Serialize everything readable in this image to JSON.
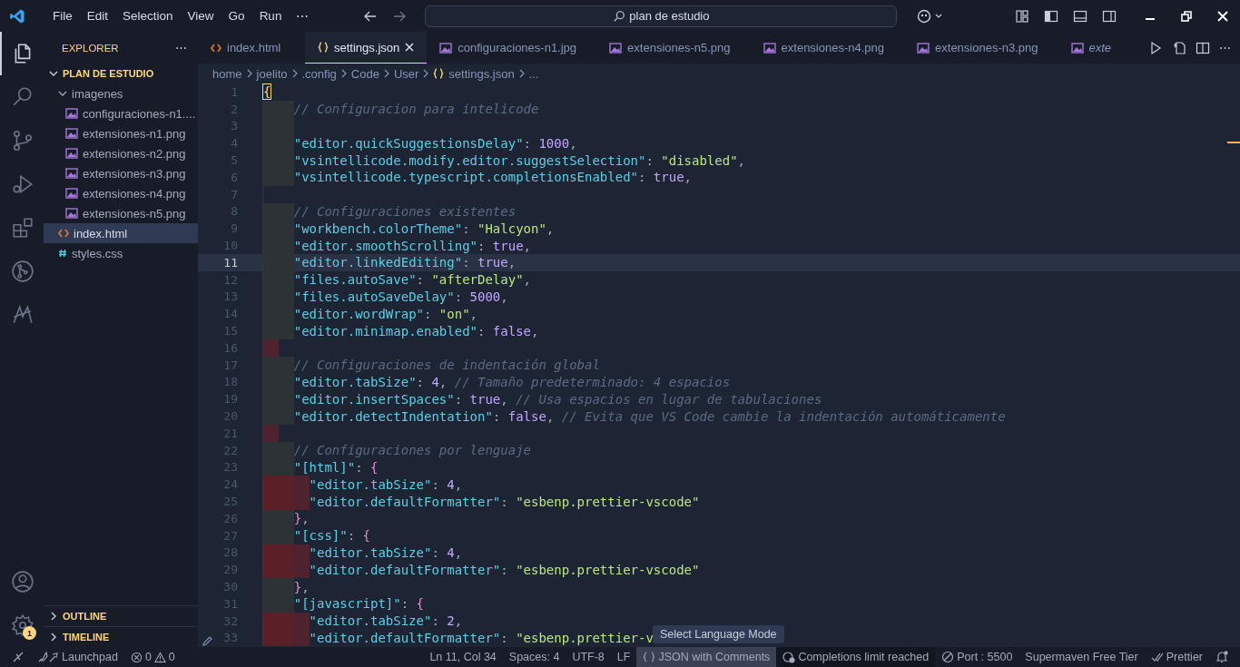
{
  "title_bar": {
    "menu": [
      "File",
      "Edit",
      "Selection",
      "View",
      "Go",
      "Run",
      "⋯"
    ],
    "search": {
      "value": "plan de estudio"
    }
  },
  "activity_bar": {
    "top": [
      {
        "kind": "explorer",
        "selected": true
      },
      {
        "kind": "search",
        "selected": false
      },
      {
        "kind": "source-control",
        "selected": false
      },
      {
        "kind": "run-debug",
        "selected": false
      },
      {
        "kind": "extensions",
        "selected": false
      },
      {
        "kind": "git-graph",
        "selected": false
      },
      {
        "kind": "custom",
        "selected": false
      }
    ],
    "bottom": [
      {
        "kind": "account"
      },
      {
        "kind": "settings",
        "badge": "1"
      }
    ]
  },
  "sidebar": {
    "title": "EXPLORER",
    "more": "⋯",
    "section": {
      "name": "PLAN DE ESTUDIO",
      "expanded": true,
      "children": [
        {
          "name": "imagenes",
          "kind": "folder",
          "expanded": true,
          "selected": false,
          "children": [
            {
              "name": "configuraciones-n1....",
              "kind": "image",
              "selected": false
            },
            {
              "name": "extensiones-n1.png",
              "kind": "image",
              "selected": false
            },
            {
              "name": "extensiones-n2.png",
              "kind": "image",
              "selected": false
            },
            {
              "name": "extensiones-n3.png",
              "kind": "image",
              "selected": false
            },
            {
              "name": "extensiones-n4.png",
              "kind": "image",
              "selected": false
            },
            {
              "name": "extensiones-n5.png",
              "kind": "image",
              "selected": false
            }
          ]
        },
        {
          "name": "index.html",
          "kind": "html",
          "selected": true
        },
        {
          "name": "styles.css",
          "kind": "css",
          "selected": false
        }
      ]
    },
    "panels": [
      {
        "name": "OUTLINE",
        "expanded": false
      },
      {
        "name": "TIMELINE",
        "expanded": false
      }
    ]
  },
  "tabs": [
    {
      "label": "index.html",
      "kind": "html",
      "selected": false,
      "preview": false
    },
    {
      "label": "settings.json",
      "kind": "json",
      "selected": true,
      "preview": false
    },
    {
      "label": "configuraciones-n1.jpg",
      "kind": "image",
      "selected": false,
      "preview": false
    },
    {
      "label": "extensiones-n5.png",
      "kind": "image",
      "selected": false,
      "preview": false
    },
    {
      "label": "extensiones-n4.png",
      "kind": "image",
      "selected": false,
      "preview": false
    },
    {
      "label": "extensiones-n3.png",
      "kind": "image",
      "selected": false,
      "preview": false
    },
    {
      "label": "exte",
      "kind": "image",
      "selected": false,
      "preview": true
    }
  ],
  "breadcrumbs": [
    {
      "text": "home",
      "kind": "folder"
    },
    {
      "text": "joelito",
      "kind": "folder"
    },
    {
      "text": ".config",
      "kind": "folder"
    },
    {
      "text": "Code",
      "kind": "folder"
    },
    {
      "text": "User",
      "kind": "folder"
    },
    {
      "text": "settings.json",
      "kind": "json"
    },
    {
      "text": "...",
      "kind": "folder"
    }
  ],
  "editor": {
    "lines": [
      {
        "number": "1",
        "current": false,
        "tokens": [
          {
            "kind": "brace-match",
            "text": "{"
          }
        ]
      },
      {
        "number": "2",
        "current": false,
        "indent": [
          {
            "kind": "ok"
          }
        ],
        "tokens": [
          {
            "kind": "comment",
            "text": "// Configuracion para intelicode"
          }
        ]
      },
      {
        "number": "3",
        "current": false,
        "indent": [
          {
            "kind": "ok"
          }
        ]
      },
      {
        "number": "4",
        "current": false,
        "indent": [
          {
            "kind": "ok"
          }
        ],
        "tokens": [
          {
            "kind": "key",
            "text": "\"editor.quickSuggestionsDelay\""
          },
          {
            "kind": "punct",
            "text": ": "
          },
          {
            "kind": "num",
            "text": "1000"
          },
          {
            "kind": "punct",
            "text": ","
          }
        ]
      },
      {
        "number": "5",
        "current": false,
        "indent": [
          {
            "kind": "ok"
          }
        ],
        "tokens": [
          {
            "kind": "key",
            "text": "\"vsintellicode.modify.editor.suggestSelection\""
          },
          {
            "kind": "punct",
            "text": ": "
          },
          {
            "kind": "str",
            "text": "\"disabled\""
          },
          {
            "kind": "punct",
            "text": ","
          }
        ]
      },
      {
        "number": "6",
        "current": false,
        "indent": [
          {
            "kind": "ok"
          }
        ],
        "tokens": [
          {
            "kind": "key",
            "text": "\"vsintellicode.typescript.completionsEnabled\""
          },
          {
            "kind": "punct",
            "text": ": "
          },
          {
            "kind": "bool",
            "text": "true"
          },
          {
            "kind": "punct",
            "text": ","
          }
        ]
      },
      {
        "number": "7",
        "current": false
      },
      {
        "number": "8",
        "current": false,
        "indent": [
          {
            "kind": "ok"
          }
        ],
        "tokens": [
          {
            "kind": "comment",
            "text": "// Configuraciones existentes"
          }
        ]
      },
      {
        "number": "9",
        "current": false,
        "indent": [
          {
            "kind": "ok"
          }
        ],
        "tokens": [
          {
            "kind": "key",
            "text": "\"workbench.colorTheme\""
          },
          {
            "kind": "punct",
            "text": ": "
          },
          {
            "kind": "str",
            "text": "\"Halcyon\""
          },
          {
            "kind": "punct",
            "text": ","
          }
        ]
      },
      {
        "number": "10",
        "current": false,
        "indent": [
          {
            "kind": "ok"
          }
        ],
        "tokens": [
          {
            "kind": "key",
            "text": "\"editor.smoothScrolling\""
          },
          {
            "kind": "punct",
            "text": ": "
          },
          {
            "kind": "bool",
            "text": "true"
          },
          {
            "kind": "punct",
            "text": ","
          }
        ]
      },
      {
        "number": "11",
        "current": true,
        "indent": [
          {
            "kind": "ok"
          }
        ],
        "tokens": [
          {
            "kind": "key",
            "text": "\"editor.linkedEditing\""
          },
          {
            "kind": "punct",
            "text": ": "
          },
          {
            "kind": "bool",
            "text": "true"
          },
          {
            "kind": "punct",
            "text": ","
          }
        ]
      },
      {
        "number": "12",
        "current": false,
        "indent": [
          {
            "kind": "ok"
          }
        ],
        "tokens": [
          {
            "kind": "key",
            "text": "\"files.autoSave\""
          },
          {
            "kind": "punct",
            "text": ": "
          },
          {
            "kind": "str",
            "text": "\"afterDelay\""
          },
          {
            "kind": "punct",
            "text": ","
          }
        ]
      },
      {
        "number": "13",
        "current": false,
        "indent": [
          {
            "kind": "ok"
          }
        ],
        "tokens": [
          {
            "kind": "key",
            "text": "\"files.autoSaveDelay\""
          },
          {
            "kind": "punct",
            "text": ": "
          },
          {
            "kind": "num",
            "text": "5000"
          },
          {
            "kind": "punct",
            "text": ","
          }
        ]
      },
      {
        "number": "14",
        "current": false,
        "indent": [
          {
            "kind": "ok"
          }
        ],
        "tokens": [
          {
            "kind": "key",
            "text": "\"editor.wordWrap\""
          },
          {
            "kind": "punct",
            "text": ": "
          },
          {
            "kind": "str",
            "text": "\"on\""
          },
          {
            "kind": "punct",
            "text": ","
          }
        ]
      },
      {
        "number": "15",
        "current": false,
        "indent": [
          {
            "kind": "ok"
          }
        ],
        "tokens": [
          {
            "kind": "key",
            "text": "\"editor.minimap.enabled\""
          },
          {
            "kind": "punct",
            "text": ": "
          },
          {
            "kind": "bool",
            "text": "false"
          },
          {
            "kind": "punct",
            "text": ","
          }
        ]
      },
      {
        "number": "16",
        "current": false,
        "indent": [
          {
            "kind": "bad-half"
          }
        ]
      },
      {
        "number": "17",
        "current": false,
        "indent": [
          {
            "kind": "ok"
          }
        ],
        "tokens": [
          {
            "kind": "comment",
            "text": "// Configuraciones de indentación global"
          }
        ]
      },
      {
        "number": "18",
        "current": false,
        "indent": [
          {
            "kind": "ok"
          }
        ],
        "tokens": [
          {
            "kind": "key",
            "text": "\"editor.tabSize\""
          },
          {
            "kind": "punct",
            "text": ": "
          },
          {
            "kind": "num",
            "text": "4"
          },
          {
            "kind": "punct",
            "text": ", "
          },
          {
            "kind": "comment",
            "text": "// Tamaño predeterminado: 4 espacios"
          }
        ]
      },
      {
        "number": "19",
        "current": false,
        "indent": [
          {
            "kind": "ok"
          }
        ],
        "tokens": [
          {
            "kind": "key",
            "text": "\"editor.insertSpaces\""
          },
          {
            "kind": "punct",
            "text": ": "
          },
          {
            "kind": "bool",
            "text": "true"
          },
          {
            "kind": "punct",
            "text": ", "
          },
          {
            "kind": "comment",
            "text": "// Usa espacios en lugar de tabulaciones"
          }
        ]
      },
      {
        "number": "20",
        "current": false,
        "indent": [
          {
            "kind": "ok"
          }
        ],
        "tokens": [
          {
            "kind": "key",
            "text": "\"editor.detectIndentation\""
          },
          {
            "kind": "punct",
            "text": ": "
          },
          {
            "kind": "bool",
            "text": "false"
          },
          {
            "kind": "punct",
            "text": ", "
          },
          {
            "kind": "comment",
            "text": "// Evita que VS Code cambie la indentación automáticamente"
          }
        ]
      },
      {
        "number": "21",
        "current": false,
        "indent": [
          {
            "kind": "bad-half"
          }
        ]
      },
      {
        "number": "22",
        "current": false,
        "indent": [
          {
            "kind": "ok"
          }
        ],
        "tokens": [
          {
            "kind": "comment",
            "text": "// Configuraciones por lenguaje"
          }
        ]
      },
      {
        "number": "23",
        "current": false,
        "indent": [
          {
            "kind": "ok"
          }
        ],
        "tokens": [
          {
            "kind": "key",
            "text": "\"[html]\""
          },
          {
            "kind": "punct",
            "text": ": "
          },
          {
            "kind": "brace",
            "text": "{"
          }
        ]
      },
      {
        "number": "24",
        "current": false,
        "indent": [
          {
            "kind": "bad"
          },
          {
            "kind": "bad-half"
          }
        ],
        "tokens": [
          {
            "kind": "key",
            "text": "\"editor.tabSize\""
          },
          {
            "kind": "punct",
            "text": ": "
          },
          {
            "kind": "num",
            "text": "4"
          },
          {
            "kind": "punct",
            "text": ","
          }
        ]
      },
      {
        "number": "25",
        "current": false,
        "indent": [
          {
            "kind": "bad"
          },
          {
            "kind": "bad-half"
          }
        ],
        "tokens": [
          {
            "kind": "key",
            "text": "\"editor.defaultFormatter\""
          },
          {
            "kind": "punct",
            "text": ": "
          },
          {
            "kind": "str",
            "text": "\"esbenp.prettier-vscode\""
          }
        ]
      },
      {
        "number": "26",
        "current": false,
        "indent": [
          {
            "kind": "ok"
          }
        ],
        "tokens": [
          {
            "kind": "brace",
            "text": "}"
          },
          {
            "kind": "punct",
            "text": ","
          }
        ]
      },
      {
        "number": "27",
        "current": false,
        "indent": [
          {
            "kind": "ok"
          }
        ],
        "tokens": [
          {
            "kind": "key",
            "text": "\"[css]\""
          },
          {
            "kind": "punct",
            "text": ": "
          },
          {
            "kind": "brace",
            "text": "{"
          }
        ]
      },
      {
        "number": "28",
        "current": false,
        "indent": [
          {
            "kind": "bad"
          },
          {
            "kind": "bad-half"
          }
        ],
        "tokens": [
          {
            "kind": "key",
            "text": "\"editor.tabSize\""
          },
          {
            "kind": "punct",
            "text": ": "
          },
          {
            "kind": "num",
            "text": "4"
          },
          {
            "kind": "punct",
            "text": ","
          }
        ]
      },
      {
        "number": "29",
        "current": false,
        "indent": [
          {
            "kind": "bad"
          },
          {
            "kind": "bad-half"
          }
        ],
        "tokens": [
          {
            "kind": "key",
            "text": "\"editor.defaultFormatter\""
          },
          {
            "kind": "punct",
            "text": ": "
          },
          {
            "kind": "str",
            "text": "\"esbenp.prettier-vscode\""
          }
        ]
      },
      {
        "number": "30",
        "current": false,
        "indent": [
          {
            "kind": "ok"
          }
        ],
        "tokens": [
          {
            "kind": "brace",
            "text": "}"
          },
          {
            "kind": "punct",
            "text": ","
          }
        ]
      },
      {
        "number": "31",
        "current": false,
        "indent": [
          {
            "kind": "ok"
          }
        ],
        "tokens": [
          {
            "kind": "key",
            "text": "\"[javascript]\""
          },
          {
            "kind": "punct",
            "text": ": "
          },
          {
            "kind": "brace",
            "text": "{"
          }
        ]
      },
      {
        "number": "32",
        "current": false,
        "indent": [
          {
            "kind": "bad"
          },
          {
            "kind": "bad-half"
          }
        ],
        "tokens": [
          {
            "kind": "key",
            "text": "\"editor.tabSize\""
          },
          {
            "kind": "punct",
            "text": ": "
          },
          {
            "kind": "num",
            "text": "2"
          },
          {
            "kind": "punct",
            "text": ","
          }
        ]
      },
      {
        "number": "33",
        "current": false,
        "indent": [
          {
            "kind": "bad"
          },
          {
            "kind": "bad-half"
          }
        ],
        "tokens": [
          {
            "kind": "key",
            "text": "\"editor.defaultFormatter\""
          },
          {
            "kind": "punct",
            "text": ": "
          },
          {
            "kind": "str",
            "text": "\"esbenp.prettier-v"
          }
        ]
      }
    ]
  },
  "tooltip": {
    "text": "Select Language Mode"
  },
  "status_bar": {
    "left": [
      {
        "kind": "remote"
      },
      {
        "kind": "launchpad",
        "text": "Launchpad"
      },
      {
        "kind": "problems",
        "errors": "0",
        "warnings": "0"
      }
    ],
    "right": [
      {
        "kind": "plain",
        "text": "Ln 11, Col 34",
        "hovered": false
      },
      {
        "kind": "plain",
        "text": "Spaces: 4",
        "hovered": false
      },
      {
        "kind": "plain",
        "text": "UTF-8",
        "hovered": false
      },
      {
        "kind": "plain",
        "text": "LF",
        "hovered": false
      },
      {
        "kind": "language",
        "text": "JSON with Comments",
        "hovered": true
      },
      {
        "kind": "warning",
        "text": "Completions limit reached",
        "hovered": false
      },
      {
        "kind": "port",
        "text": "Port : 5500",
        "hovered": false
      },
      {
        "kind": "plain",
        "text": "Supermaven Free Tier",
        "hovered": false
      },
      {
        "kind": "prettier",
        "text": "Prettier",
        "hovered": false
      },
      {
        "kind": "bell",
        "hovered": false
      }
    ]
  }
}
